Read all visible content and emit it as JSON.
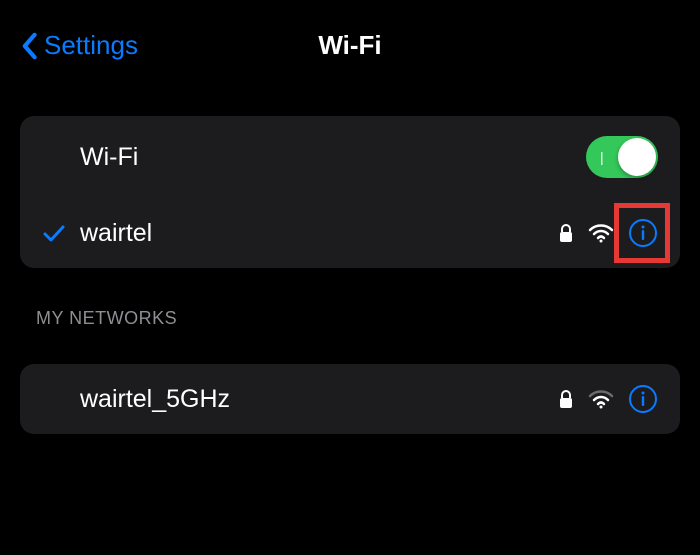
{
  "nav": {
    "back_label": "Settings",
    "title": "Wi-Fi"
  },
  "wifi_toggle": {
    "label": "Wi-Fi",
    "enabled": true
  },
  "connected_network": {
    "name": "wairtel"
  },
  "sections": {
    "my_networks": {
      "header": "My Networks",
      "items": [
        {
          "name": "wairtel_5GHz"
        }
      ]
    }
  },
  "colors": {
    "accent": "#0a7aff",
    "toggle_on": "#34c759",
    "highlight": "#e53935"
  }
}
